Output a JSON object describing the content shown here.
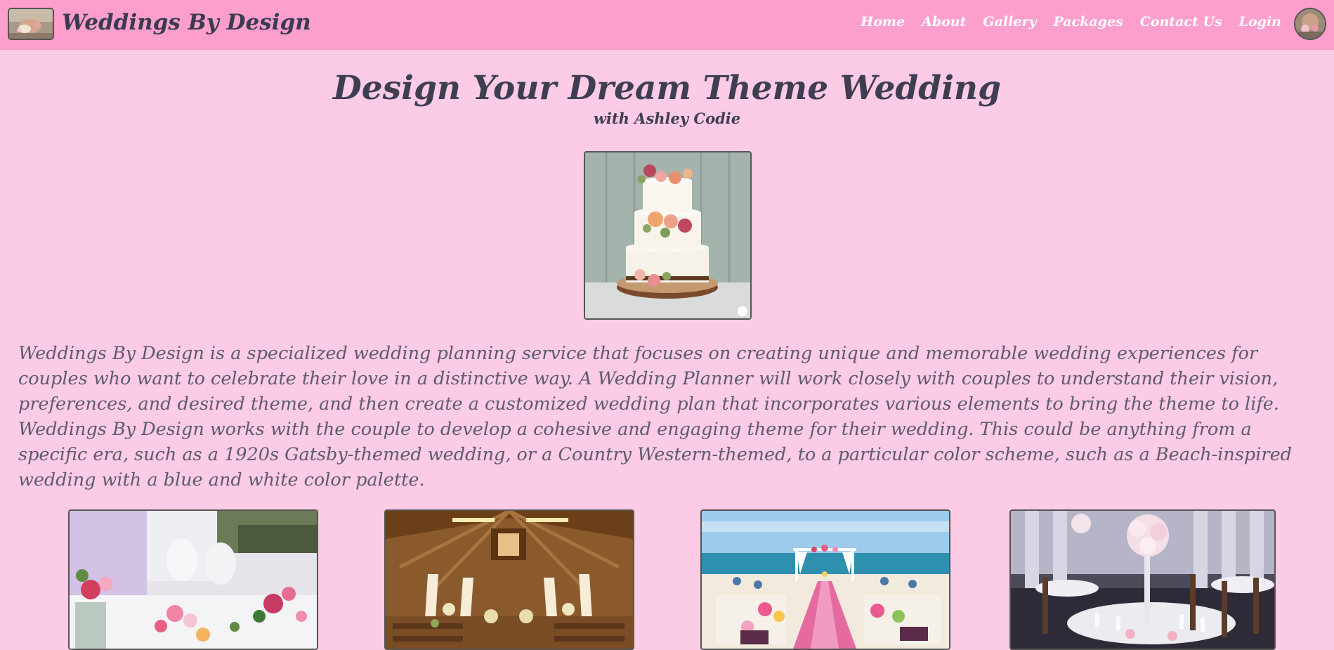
{
  "navbar": {
    "brand_name": "Weddings By Design",
    "links": [
      {
        "label": "Home"
      },
      {
        "label": "About"
      },
      {
        "label": "Gallery"
      },
      {
        "label": "Packages"
      },
      {
        "label": "Contact Us"
      },
      {
        "label": "Login"
      }
    ]
  },
  "hero": {
    "title": "Design Your Dream Theme Wedding",
    "subtitle": "with Ashley Codie"
  },
  "description": "Weddings By Design is a specialized wedding planning service that focuses on creating unique and memorable wedding experiences for couples who want to celebrate their love in a distinctive way. A Wedding Planner will work closely with couples to understand their vision, preferences, and desired theme, and then create a customized wedding plan that incorporates various elements to bring the theme to life. Weddings By Design works with the couple to develop a cohesive and engaging theme for their wedding. This could be anything from a specific era, such as a 1920s Gatsby-themed wedding, or a Country Western-themed, to a particular color scheme, such as a Beach-inspired wedding with a blue and white color palette.",
  "colors": {
    "page_background": "#fccbe6",
    "navbar_background": "#fd9fcd",
    "nav_link": "#ffffff",
    "heading": "#3e3e52",
    "body_text": "#5d5b6d"
  },
  "gallery": [
    {
      "image": "floral-table-setting-image"
    },
    {
      "image": "rustic-barn-ceremony-image"
    },
    {
      "image": "beach-ceremony-image"
    },
    {
      "image": "elegant-reception-hall-image"
    }
  ]
}
